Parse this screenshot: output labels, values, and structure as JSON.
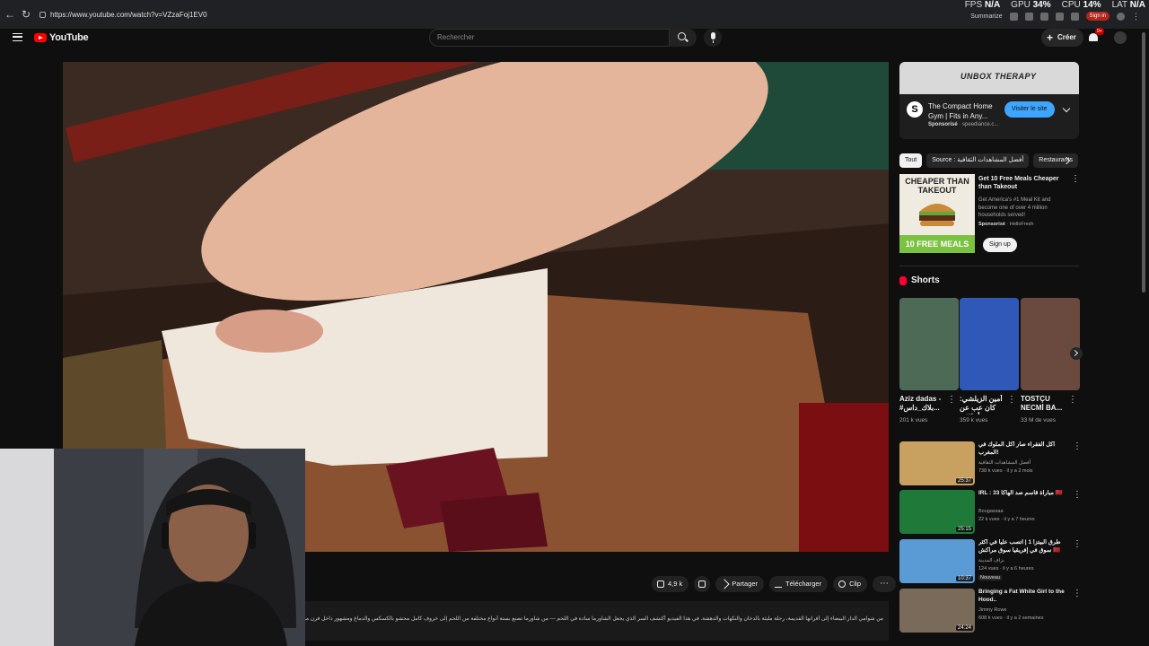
{
  "browser": {
    "url": "https://www.youtube.com/watch?v=VZzaFoj1EV0",
    "perf": {
      "fps_label": "FPS",
      "fps_value": "N/A",
      "gpu_label": "GPU",
      "gpu_value": "34%",
      "cpu_label": "CPU",
      "cpu_value": "14%",
      "lat_label": "LAT",
      "lat_value": "N/A"
    },
    "summarize_label": "Summarize",
    "signin_label": "Sign in"
  },
  "masthead": {
    "logo_text": "YouTube",
    "search_placeholder": "Rechercher",
    "create_label": "Créer",
    "notification_count": "9+"
  },
  "player": {
    "like_count": "4,9 k",
    "share_label": "Partager",
    "download_label": "Télécharger",
    "clip_label": "Clip",
    "description": "من شوامي الدار البيضاء إلى أفرانها القديمة، رحلة مليئة بالدخان والنكهات والدهشة. في هذا الفيديو أكتشف السر الذي يجعل الشاورما سادة في اللحم — من شاورما تصنع بستة أنواع مختلفة من اللحم إلى خروف كامل محشو بالكسكس والدماغ ومشهور داخل فرن مشتول الجمل، الطيب يحكي ما يُحكى"
  },
  "sidebar": {
    "ad": {
      "banner_brand": "UNBOX THERAPY",
      "logo_letter": "S",
      "title": "The Compact Home Gym | Fits in Any...",
      "sponsored": "Sponsorisé",
      "domain": "speediance.c...",
      "visit_label": "Visiter le site"
    },
    "chips": [
      {
        "label": "Tout",
        "active": true
      },
      {
        "label": "Source : أفضل المشاهدات الثقافية",
        "active": false
      },
      {
        "label": "Restaurants",
        "active": false
      }
    ],
    "promo": {
      "thumb_top": "CHEAPER THAN TAKEOUT",
      "thumb_bottom": "10 FREE MEALS",
      "title": "Get 10 Free Meals Cheaper than Takeout",
      "body": "Get America's #1 Meal Kit and become one of over 4 million households served!",
      "sponsored": "Sponsorisé",
      "advertiser": "HelloFresh",
      "cta": "Sign up"
    },
    "shorts_title": "Shorts",
    "shorts": [
      {
        "title": "Aziz dadas - #بلاك_داس...",
        "views": "201 k vues",
        "thumb_color": "#4d6a57"
      },
      {
        "title": "أمين الزيلشي: كان عب عن أخلاقي...",
        "views": "359 k vues",
        "thumb_color": "#2f58b8"
      },
      {
        "title": "TOSTÇU NECMİ BA...",
        "views": "33 M de vues",
        "thumb_color": "#6a4a3e"
      }
    ],
    "videos": [
      {
        "title": "أكل الفقراء صار أكل الملوك في المغرب!",
        "channel": "أفضل المشاهدات الثقافية",
        "meta": "738 k vues · il y a 2 mois",
        "duration": "25:37",
        "badge": "",
        "thumb_color": "#c8a060"
      },
      {
        "title": "IRL : 33 مباراة قاسم صد الهاكا 🇲🇦",
        "channel": "Bougassaa",
        "meta": "22 k vues · il y a 7 heures",
        "duration": "25:15",
        "badge": "",
        "thumb_color": "#1f7a3a"
      },
      {
        "title": "طرق البيتزا 1 | اتصب عليا في أكثر سوق في إفريقيا سوق مراكش 🇲🇦",
        "channel": "بزاف المدينة",
        "meta": "124 vues · il y a 6 heures",
        "duration": "10:37",
        "badge": "Nouveau",
        "thumb_color": "#5a9bd5"
      },
      {
        "title": "Bringing a Fat White Girl to the Hood..",
        "channel": "Jimmy Rowe",
        "meta": "608 k vues · il y a 2 semaines",
        "duration": "24:24",
        "badge": "",
        "thumb_color": "#7a6a5a"
      }
    ]
  }
}
